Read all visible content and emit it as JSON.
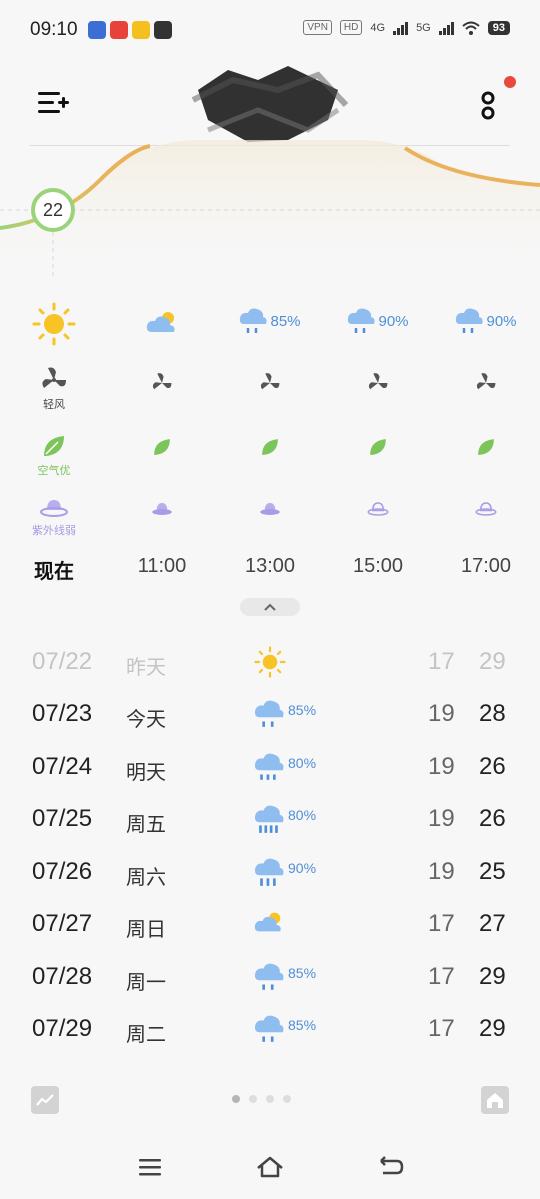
{
  "status_bar": {
    "time": "09:10",
    "network_4g": "4G",
    "network_5g": "5G",
    "vpn": "VPN",
    "hd": "HD",
    "battery": "93"
  },
  "header": {
    "menu_icon": "menu-add-icon",
    "more_icon": "more-dots-icon"
  },
  "current": {
    "temperature": "22"
  },
  "hourly": [
    {
      "time": "现在",
      "weather": "sunny",
      "precip": "",
      "wind_label": "轻风",
      "air_label": "空气优",
      "uv_label": "紫外线弱"
    },
    {
      "time": "11:00",
      "weather": "partly-cloudy",
      "precip": "",
      "wind_label": "",
      "air_label": "",
      "uv_label": ""
    },
    {
      "time": "13:00",
      "weather": "rain",
      "precip": "85%",
      "wind_label": "",
      "air_label": "",
      "uv_label": ""
    },
    {
      "time": "15:00",
      "weather": "rain",
      "precip": "90%",
      "wind_label": "",
      "air_label": "",
      "uv_label": ""
    },
    {
      "time": "17:00",
      "weather": "rain",
      "precip": "90%",
      "wind_label": "",
      "air_label": "",
      "uv_label": ""
    }
  ],
  "daily": [
    {
      "date": "07/22",
      "day": "昨天",
      "weather": "sunny",
      "precip": "",
      "low": "17",
      "high": "29",
      "past": true
    },
    {
      "date": "07/23",
      "day": "今天",
      "weather": "rain",
      "precip": "85%",
      "low": "19",
      "high": "28",
      "past": false
    },
    {
      "date": "07/24",
      "day": "明天",
      "weather": "rain",
      "precip": "80%",
      "low": "19",
      "high": "26",
      "past": false
    },
    {
      "date": "07/25",
      "day": "周五",
      "weather": "heavy-rain",
      "precip": "80%",
      "low": "19",
      "high": "26",
      "past": false
    },
    {
      "date": "07/26",
      "day": "周六",
      "weather": "heavy-rain",
      "precip": "90%",
      "low": "19",
      "high": "25",
      "past": false
    },
    {
      "date": "07/27",
      "day": "周日",
      "weather": "partly-cloudy",
      "precip": "",
      "low": "17",
      "high": "27",
      "past": false
    },
    {
      "date": "07/28",
      "day": "周一",
      "weather": "rain",
      "precip": "85%",
      "low": "17",
      "high": "29",
      "past": false
    },
    {
      "date": "07/29",
      "day": "周二",
      "weather": "rain",
      "precip": "85%",
      "low": "17",
      "high": "29",
      "past": false
    }
  ],
  "colors": {
    "accent_blue": "#4f8fd6",
    "sun": "#f7c325",
    "air_green": "#7cc55a",
    "uv_purple": "#a99be6",
    "curve_green": "#9bd37a",
    "curve_orange": "#eab25c",
    "alert_red": "#e84b3c"
  },
  "pager": {
    "total": 4,
    "active": 0
  }
}
